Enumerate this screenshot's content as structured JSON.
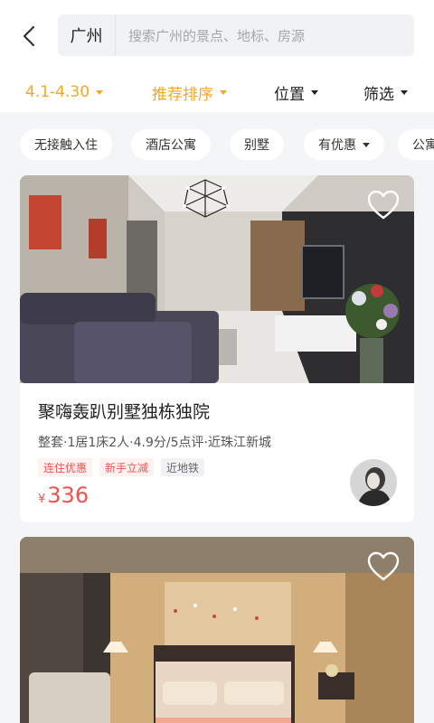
{
  "header": {
    "city": "广州",
    "search_placeholder": "搜索广州的景点、地标、房源"
  },
  "filters": {
    "date": "4.1-4.30",
    "sort": "推荐排序",
    "location": "位置",
    "filter": "筛选"
  },
  "quick_tags": [
    "无接触入住",
    "酒店公寓",
    "别墅",
    "有优惠",
    "公寓"
  ],
  "listings": [
    {
      "title": "聚嗨轰趴别墅独栋独院",
      "meta": "整套·1居1床2人·4.9分/5点评·近珠江新城",
      "badges": [
        {
          "text": "连住优惠",
          "style": "red"
        },
        {
          "text": "新手立减",
          "style": "red"
        },
        {
          "text": "近地铁",
          "style": "gray"
        }
      ],
      "currency": "¥",
      "price": "336"
    }
  ],
  "colors": {
    "accent": "#f5a623",
    "price": "#f0524f",
    "background": "#f4f5f7"
  },
  "icons": {
    "back": "chevron-left-icon",
    "favorite": "heart-outline-icon"
  }
}
